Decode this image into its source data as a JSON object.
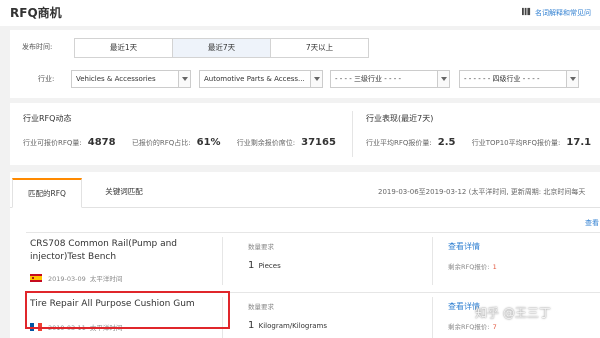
{
  "header": {
    "title": "RFQ商机",
    "help_text": "名词解释和常见问"
  },
  "filters": {
    "time_label": "发布时间:",
    "time_options": [
      "最近1天",
      "最近7天",
      "7天以上"
    ],
    "industry_label": "行业:",
    "selects": [
      "Vehicles & Accessories",
      "Automotive Parts & Access...",
      "- - - - 三级行业 - - - -",
      "- - - - - - 四级行业 - - - -"
    ]
  },
  "stats": {
    "left_title": "行业RFQ动态",
    "right_title": "行业表现(最近7天)",
    "items": [
      {
        "label": "行业可报价RFQ量:",
        "value": "4878"
      },
      {
        "label": "已报价的RFQ占比:",
        "value": "61%"
      },
      {
        "label": "行业剩余报价席位:",
        "value": "37165"
      },
      {
        "label": "行业平均RFQ报价量:",
        "value": "2.5"
      },
      {
        "label": "行业TOP10平均RFQ报价量:",
        "value": "17.1"
      }
    ]
  },
  "tabs": {
    "items": [
      "匹配的RFQ",
      "关键词匹配"
    ],
    "date_range": "2019-03-06至2019-03-12 (太平洋时间, 更新周期: 北京时间每天"
  },
  "list": {
    "view_more": "查看",
    "rows": [
      {
        "title": "CRS708 Common Rail(Pump and injector)Test Bench",
        "date": "2019-03-09",
        "timezone": "太平洋时间",
        "qty_label": "数量要求",
        "qty_value": "1",
        "qty_unit": "Pieces",
        "detail": "查看详情",
        "remaining_label": "剩余RFQ报价:",
        "remaining_value": "1"
      },
      {
        "title": "Tire Repair All Purpose Cushion Gum",
        "date": "2019-03-11",
        "timezone": "太平洋时间",
        "qty_label": "数量要求",
        "qty_value": "1",
        "qty_unit": "Kilogram/Kilograms",
        "detail": "查看详情",
        "remaining_label": "剩余RFQ报价:",
        "remaining_value": "7"
      }
    ]
  },
  "watermark": "知乎 @王三丁",
  "colors": {
    "accent": "#ff8a00",
    "link": "#2f7fd1",
    "highlight": "#e0262b"
  }
}
